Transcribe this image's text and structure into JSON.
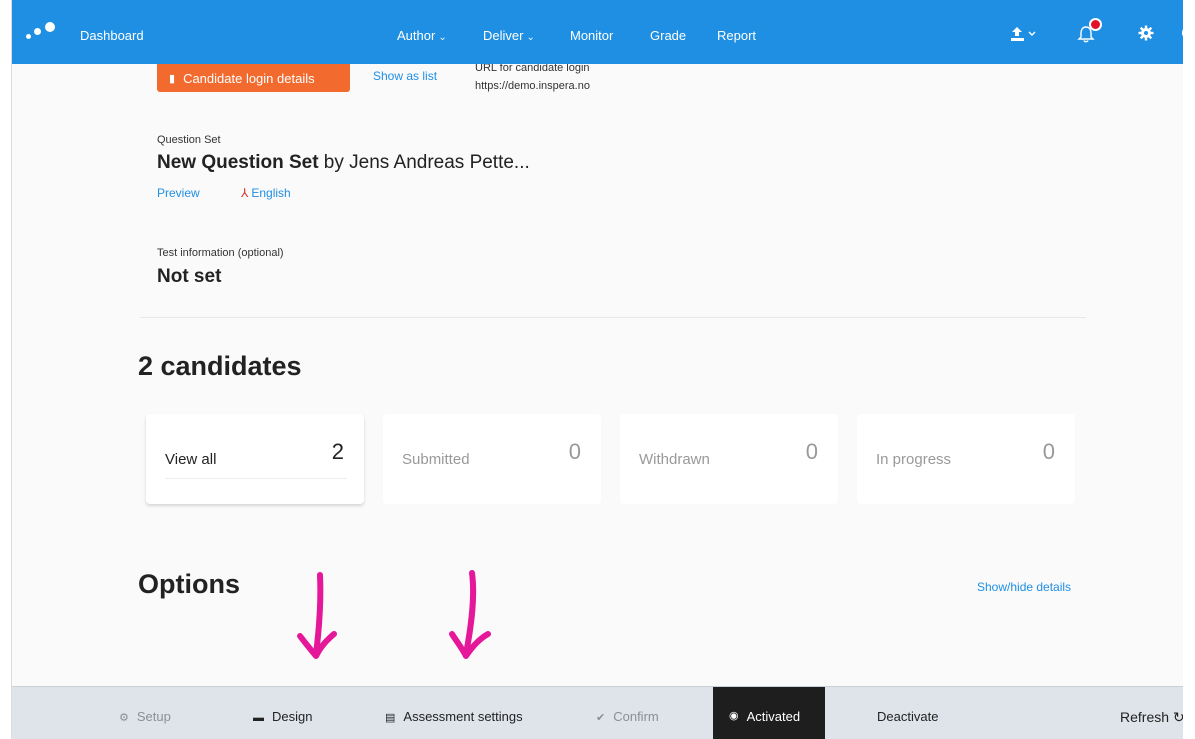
{
  "topbar": {
    "dashboard_label": "Dashboard",
    "nav": {
      "author": "Author",
      "deliver": "Deliver",
      "monitor": "Monitor",
      "grade": "Grade",
      "report": "Report"
    },
    "accent_color": "#1f8fe3",
    "notification_color": "#e3102a"
  },
  "login": {
    "button_label": "Candidate login details",
    "show_as_list": "Show as list",
    "url_label": "URL for candidate login",
    "url_value": "https://demo.inspera.no",
    "button_color": "#f26a2e"
  },
  "question_set": {
    "label": "Question Set",
    "title": "New Question Set",
    "by": " by Jens Andreas Pette...",
    "preview": "Preview",
    "language": "English"
  },
  "test_info": {
    "label": "Test information (optional)",
    "value": "Not set"
  },
  "candidates": {
    "heading": "2 candidates",
    "cards": [
      {
        "label": "View all",
        "count": "2"
      },
      {
        "label": "Submitted",
        "count": "0"
      },
      {
        "label": "Withdrawn",
        "count": "0"
      },
      {
        "label": "In progress",
        "count": "0"
      }
    ]
  },
  "options": {
    "heading": "Options",
    "show_hide": "Show/hide details"
  },
  "bottombar": {
    "steps": {
      "setup": "Setup",
      "design": "Design",
      "assessment": "Assessment settings",
      "confirm": "Confirm",
      "activated": "Activated",
      "deactivate": "Deactivate"
    },
    "refresh": "Refresh"
  },
  "annotation_color": "#e5189a"
}
